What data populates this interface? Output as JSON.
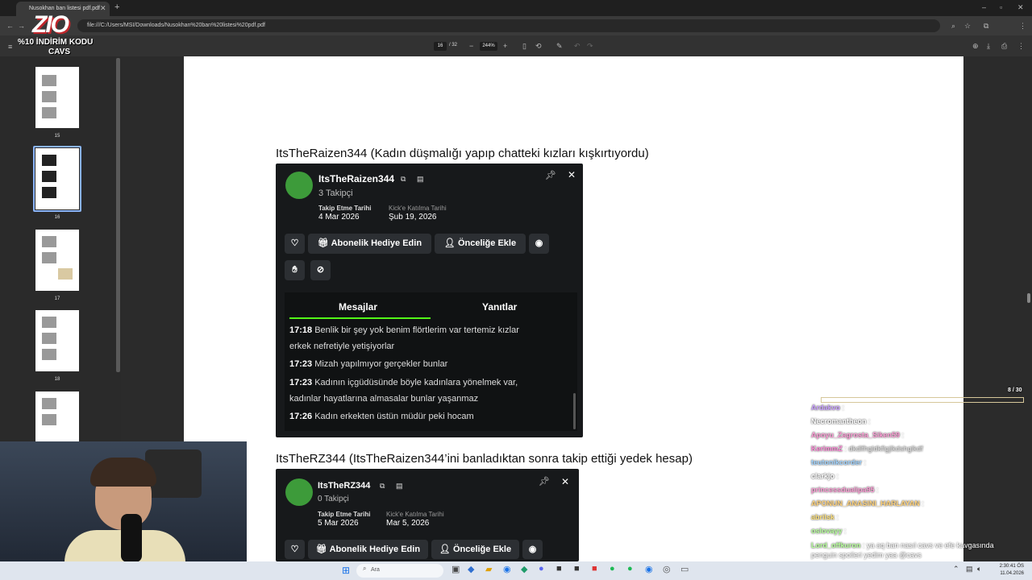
{
  "browser": {
    "tab_title": "Nusokhan ban listesi pdf.pdf",
    "url": "file:///C:/Users/MSI/Downloads/Nusokhan%20ban%20listesi%20pdf.pdf"
  },
  "pdf_toolbar": {
    "page_current": "16",
    "page_total": "/ 32",
    "zoom": "244%"
  },
  "overlay": {
    "logo": "ZIO",
    "promo_line1": "%10 İNDİRİM KODU",
    "promo_line2": "CAVS"
  },
  "thumbnails": [
    "15",
    "16",
    "17",
    "18"
  ],
  "entries": [
    {
      "heading": "ItsTheRaizen344 (Kadın düşmalığı yapıp chatteki kızları kışkırtıyordu)",
      "username": "ItsTheRaizen344",
      "followers": "3 Takipçi",
      "follow_date_label": "Takip Etme Tarihi",
      "follow_date": "4 Mar 2026",
      "join_date_label": "Kick'e Katılma Tarihi",
      "join_date": "Şub 19, 2026",
      "gift_label": "Abonelik Hediye Edin",
      "priority_label": "Önceliğe Ekle",
      "tab_messages": "Mesajlar",
      "tab_replies": "Yanıtlar",
      "messages": [
        {
          "time": "17:18",
          "line1": "Benlik bir şey yok benim flörtlerim var tertemiz kızlar",
          "line2": "erkek nefretiyle yetişiyorlar"
        },
        {
          "time": "17:23",
          "line1": "Mizah yapılmıyor gerçekler bunlar",
          "line2": ""
        },
        {
          "time": "17:23",
          "line1": "Kadının içgüdüsünde böyle kadınlara yönelmek var,",
          "line2": "kadınlar hayatlarına almasalar bunlar yaşanmaz"
        },
        {
          "time": "17:26",
          "line1": "Kadın erkekten üstün müdür peki hocam",
          "line2": ""
        }
      ]
    },
    {
      "heading": "ItsTheRZ344 (ItsTheRaizen344’ini banladıktan sonra takip ettiği yedek hesap)",
      "username": "ItsTheRZ344",
      "followers": "0 Takipçi",
      "follow_date_label": "Takip Etme Tarihi",
      "follow_date": "5 Mar 2026",
      "join_date_label": "Kick'e Katılma Tarihi",
      "join_date": "Mar 5, 2026",
      "gift_label": "Abonelik Hediye Edin",
      "priority_label": "Önceliğe Ekle"
    }
  ],
  "chat": {
    "progress": "8 / 30",
    "messages": [
      {
        "user": "Ardakvo",
        "text": "",
        "color": "#c9a0ff"
      },
      {
        "user": "Necromantheon",
        "text": "",
        "color": "#ffffff"
      },
      {
        "user": "Apoyu_Zagrosta_Siken59",
        "text": "",
        "color": "#ff9bd6"
      },
      {
        "user": "KerimmZ",
        "text": "dkdlfhgldkflgjlkdshglkdf",
        "color": "#ff8ad8"
      },
      {
        "user": "teutonikcorder",
        "text": "",
        "color": "#9fd3ff"
      },
      {
        "user": "clarkjo",
        "text": "",
        "color": "#ffffff"
      },
      {
        "user": "princessdualipa95",
        "text": "",
        "color": "#ff9bd6"
      },
      {
        "user": "APONUN_ANASINI_HARLAYAN",
        "text": "",
        "color": "#ffd27a"
      },
      {
        "user": "abrilsk",
        "text": "",
        "color": "#ffe27a"
      },
      {
        "user": "oslovayy",
        "text": "",
        "color": "#b6ff9a"
      },
      {
        "user": "Lord_offkuron",
        "text": "ya aq ban nasıl cavs ve efe kavgasında penguin spoileri yedim yaa @cavs",
        "color": "#b6ff9a"
      },
      {
        "user": "atesparem",
        "text": "",
        "color": "#ff9bd6"
      }
    ]
  },
  "taskbar": {
    "search_placeholder": "Ara",
    "time": "2:30:41 ÖS",
    "date": "11.04.2026"
  }
}
